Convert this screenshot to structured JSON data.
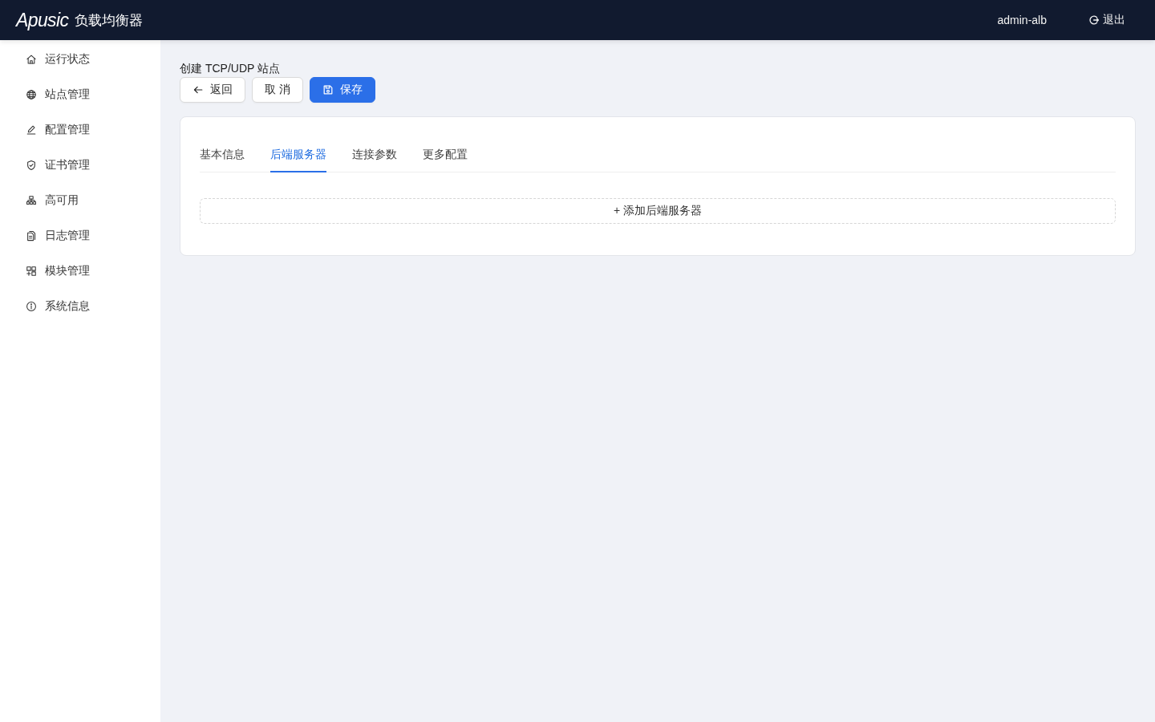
{
  "header": {
    "logo": {
      "brand": "Apusic",
      "product": "负载均衡器"
    },
    "user": "admin-alb",
    "logout": "退出"
  },
  "sidebar": {
    "items": [
      {
        "label": "运行状态",
        "selected": false
      },
      {
        "label": "站点管理",
        "selected": false
      },
      {
        "label": "配置管理",
        "selected": false
      },
      {
        "label": "证书管理",
        "selected": false
      },
      {
        "label": "高可用",
        "selected": false
      },
      {
        "label": "日志管理",
        "selected": false
      },
      {
        "label": "模块管理",
        "selected": false
      },
      {
        "label": "系统信息",
        "selected": false
      }
    ]
  },
  "page": {
    "title": "创建 TCP/UDP 站点",
    "actions": {
      "back": "返回",
      "cancel": "取 消",
      "save": "保存"
    },
    "tabs": [
      {
        "label": "基本信息",
        "selected": false
      },
      {
        "label": "后端服务器",
        "selected": true
      },
      {
        "label": "连接参数",
        "selected": false
      },
      {
        "label": "更多配置",
        "selected": false
      }
    ],
    "add_button": "+ 添加后端服务器"
  }
}
